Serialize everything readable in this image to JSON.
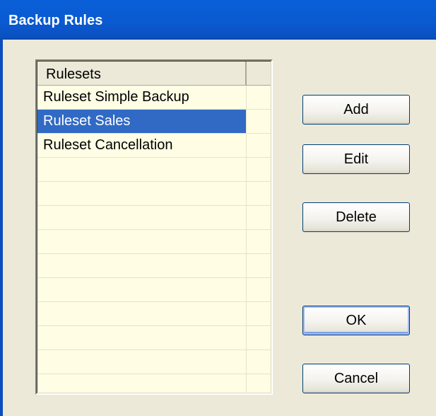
{
  "window": {
    "title": "Backup Rules"
  },
  "listview": {
    "column_header": "Rulesets",
    "items": [
      {
        "label": "Ruleset Simple Backup",
        "selected": false
      },
      {
        "label": "Ruleset Sales",
        "selected": true
      },
      {
        "label": "Ruleset Cancellation",
        "selected": false
      }
    ]
  },
  "buttons": {
    "add": "Add",
    "edit": "Edit",
    "delete": "Delete",
    "ok": "OK",
    "cancel": "Cancel"
  },
  "colors": {
    "title_bar": "#0a5ad1",
    "dialog_background": "#ece9d8",
    "list_background": "#fffee5",
    "selection": "#316ac5"
  }
}
